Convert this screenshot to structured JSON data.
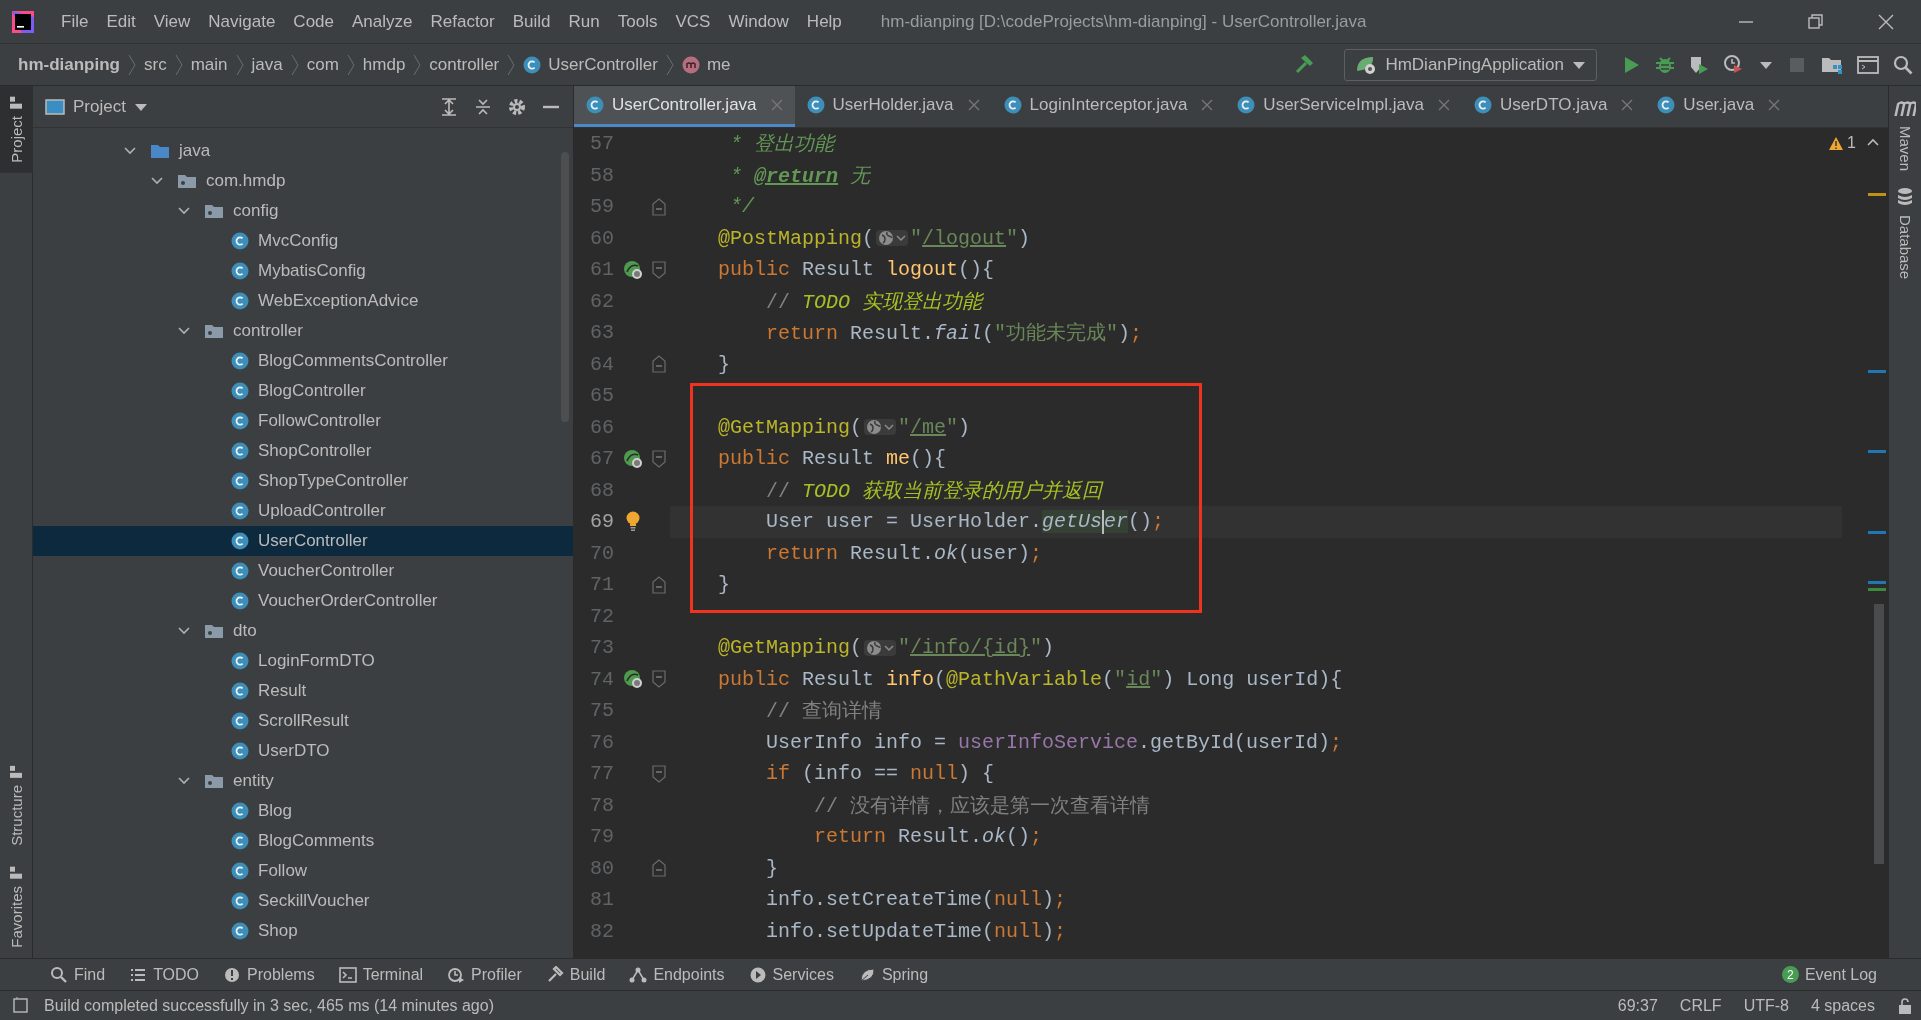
{
  "window": {
    "title": "hm-dianping [D:\\codeProjects\\hm-dianping] - UserController.java"
  },
  "menu": [
    "File",
    "Edit",
    "View",
    "Navigate",
    "Code",
    "Analyze",
    "Refactor",
    "Build",
    "Run",
    "Tools",
    "VCS",
    "Window",
    "Help"
  ],
  "breadcrumbs": [
    {
      "label": "hm-dianping",
      "kind": "project"
    },
    {
      "label": "src",
      "kind": "folder"
    },
    {
      "label": "main",
      "kind": "folder"
    },
    {
      "label": "java",
      "kind": "folder"
    },
    {
      "label": "com",
      "kind": "folder"
    },
    {
      "label": "hmdp",
      "kind": "folder"
    },
    {
      "label": "controller",
      "kind": "folder"
    },
    {
      "label": "UserController",
      "kind": "class"
    },
    {
      "label": "me",
      "kind": "method"
    }
  ],
  "run_config": {
    "label": "HmDianPingApplication"
  },
  "left_tools": [
    {
      "label": "Project",
      "selected": true,
      "kind": "top"
    },
    {
      "label": "Structure",
      "selected": false,
      "kind": "bottom"
    },
    {
      "label": "Favorites",
      "selected": false,
      "kind": "bottom"
    }
  ],
  "right_tools": [
    {
      "label": "Maven",
      "kind": "maven"
    },
    {
      "label": "Database",
      "kind": "database"
    }
  ],
  "project_panel": {
    "title": "Project",
    "tree": [
      {
        "label": "java",
        "kind": "source",
        "expanded": true,
        "selected": false,
        "children": [
          {
            "label": "com.hmdp",
            "kind": "package",
            "expanded": true,
            "selected": false,
            "children": [
              {
                "label": "config",
                "kind": "package",
                "expanded": true,
                "selected": false,
                "children": [
                  {
                    "label": "MvcConfig",
                    "kind": "class",
                    "selected": false
                  },
                  {
                    "label": "MybatisConfig",
                    "kind": "class",
                    "selected": false
                  },
                  {
                    "label": "WebExceptionAdvice",
                    "kind": "class",
                    "selected": false
                  }
                ]
              },
              {
                "label": "controller",
                "kind": "package",
                "expanded": true,
                "selected": false,
                "children": [
                  {
                    "label": "BlogCommentsController",
                    "kind": "class",
                    "selected": false
                  },
                  {
                    "label": "BlogController",
                    "kind": "class",
                    "selected": false
                  },
                  {
                    "label": "FollowController",
                    "kind": "class",
                    "selected": false
                  },
                  {
                    "label": "ShopController",
                    "kind": "class",
                    "selected": false
                  },
                  {
                    "label": "ShopTypeController",
                    "kind": "class",
                    "selected": false
                  },
                  {
                    "label": "UploadController",
                    "kind": "class",
                    "selected": false
                  },
                  {
                    "label": "UserController",
                    "kind": "class",
                    "selected": true
                  },
                  {
                    "label": "VoucherController",
                    "kind": "class",
                    "selected": false
                  },
                  {
                    "label": "VoucherOrderController",
                    "kind": "class",
                    "selected": false
                  }
                ]
              },
              {
                "label": "dto",
                "kind": "package",
                "expanded": true,
                "selected": false,
                "children": [
                  {
                    "label": "LoginFormDTO",
                    "kind": "class",
                    "selected": false
                  },
                  {
                    "label": "Result",
                    "kind": "class",
                    "selected": false
                  },
                  {
                    "label": "ScrollResult",
                    "kind": "class",
                    "selected": false
                  },
                  {
                    "label": "UserDTO",
                    "kind": "class",
                    "selected": false
                  }
                ]
              },
              {
                "label": "entity",
                "kind": "package",
                "expanded": true,
                "selected": false,
                "children": [
                  {
                    "label": "Blog",
                    "kind": "class",
                    "selected": false
                  },
                  {
                    "label": "BlogComments",
                    "kind": "class",
                    "selected": false
                  },
                  {
                    "label": "Follow",
                    "kind": "class",
                    "selected": false
                  },
                  {
                    "label": "SeckillVoucher",
                    "kind": "class",
                    "selected": false
                  },
                  {
                    "label": "Shop",
                    "kind": "class",
                    "selected": false
                  }
                ]
              }
            ]
          }
        ]
      }
    ]
  },
  "tabs": [
    {
      "label": "UserController.java",
      "selected": true
    },
    {
      "label": "UserHolder.java",
      "selected": false
    },
    {
      "label": "LoginInterceptor.java",
      "selected": false
    },
    {
      "label": "UserServiceImpl.java",
      "selected": false
    },
    {
      "label": "UserDTO.java",
      "selected": false
    },
    {
      "label": "User.java",
      "selected": false
    }
  ],
  "inspections": {
    "warnings": "1"
  },
  "code": [
    {
      "boxed": false,
      "lines": [
        {
          "number": "57",
          "current": false,
          "kind": "doc",
          "tokens": [
            {
              "kind": "doc",
              "text": "* 登出功能"
            }
          ]
        },
        {
          "number": "58",
          "current": false,
          "kind": "doc",
          "tokens": [
            {
              "kind": "doc",
              "text": "* "
            },
            {
              "kind": "doctag",
              "text": "@return"
            },
            {
              "kind": "doc",
              "text": " 无"
            }
          ]
        },
        {
          "number": "59",
          "current": false,
          "kind": "doc",
          "fold": {
            "kind": "end"
          },
          "tokens": [
            {
              "kind": "doc",
              "text": "*/"
            }
          ]
        },
        {
          "number": "60",
          "current": false,
          "kind": "member",
          "tokens": [
            {
              "kind": "ann",
              "text": "@PostMapping"
            },
            {
              "kind": "plain",
              "text": "("
            },
            {
              "kind": "inlay"
            },
            {
              "kind": "str",
              "text": "\""
            },
            {
              "kind": "url",
              "text": "/logout"
            },
            {
              "kind": "str",
              "text": "\""
            },
            {
              "kind": "plain",
              "text": ")"
            }
          ]
        },
        {
          "number": "61",
          "current": false,
          "kind": "member",
          "gutter": {
            "kind": "endpoint"
          },
          "fold": {
            "kind": "start"
          },
          "tokens": [
            {
              "kind": "kw",
              "text": "public"
            },
            {
              "kind": "plain",
              "text": " Result "
            },
            {
              "kind": "decl",
              "text": "logout"
            },
            {
              "kind": "plain",
              "text": "(){"
            }
          ]
        },
        {
          "number": "62",
          "current": false,
          "kind": "body",
          "tokens": [
            {
              "kind": "comment",
              "text": "// "
            },
            {
              "kind": "todo",
              "text": "TODO 实现登出功能"
            }
          ]
        },
        {
          "number": "63",
          "current": false,
          "kind": "body",
          "tokens": [
            {
              "kind": "kw",
              "text": "return"
            },
            {
              "kind": "plain",
              "text": " Result."
            },
            {
              "kind": "static",
              "text": "fail"
            },
            {
              "kind": "plain",
              "text": "("
            },
            {
              "kind": "str",
              "text": "\"功能未完成\""
            },
            {
              "kind": "plain",
              "text": ")"
            },
            {
              "kind": "kw",
              "text": ";"
            }
          ]
        },
        {
          "number": "64",
          "current": false,
          "kind": "member",
          "fold": {
            "kind": "end"
          },
          "tokens": [
            {
              "kind": "plain",
              "text": "}"
            }
          ]
        }
      ]
    },
    {
      "boxed": true,
      "lines": [
        {
          "number": "65",
          "current": false,
          "kind": "blank"
        },
        {
          "number": "66",
          "current": false,
          "kind": "member",
          "tokens": [
            {
              "kind": "ann",
              "text": "@GetMapping"
            },
            {
              "kind": "plain",
              "text": "("
            },
            {
              "kind": "inlay"
            },
            {
              "kind": "str",
              "text": "\""
            },
            {
              "kind": "url",
              "text": "/me"
            },
            {
              "kind": "str",
              "text": "\""
            },
            {
              "kind": "plain",
              "text": ")"
            }
          ]
        },
        {
          "number": "67",
          "current": false,
          "kind": "member",
          "gutter": {
            "kind": "endpoint"
          },
          "fold": {
            "kind": "start"
          },
          "tokens": [
            {
              "kind": "kw",
              "text": "public"
            },
            {
              "kind": "plain",
              "text": " Result "
            },
            {
              "kind": "decl",
              "text": "me"
            },
            {
              "kind": "plain",
              "text": "(){"
            }
          ]
        },
        {
          "number": "68",
          "current": false,
          "kind": "body",
          "tokens": [
            {
              "kind": "comment",
              "text": "// "
            },
            {
              "kind": "todo",
              "text": "TODO 获取当前登录的用户并返回"
            }
          ]
        },
        {
          "number": "69",
          "current": true,
          "kind": "body",
          "gutter": {
            "kind": "bulb"
          },
          "tokens": [
            {
              "kind": "plain",
              "text": "User user = UserHolder."
            },
            {
              "kind": "usage",
              "text": "getUs"
            },
            {
              "kind": "caret"
            },
            {
              "kind": "usage",
              "text": "er"
            },
            {
              "kind": "plain",
              "text": "()"
            },
            {
              "kind": "kw",
              "text": ";"
            }
          ]
        },
        {
          "number": "70",
          "current": false,
          "kind": "body",
          "tokens": [
            {
              "kind": "kw",
              "text": "return"
            },
            {
              "kind": "plain",
              "text": " Result."
            },
            {
              "kind": "static",
              "text": "ok"
            },
            {
              "kind": "plain",
              "text": "(user)"
            },
            {
              "kind": "kw",
              "text": ";"
            }
          ]
        },
        {
          "number": "71",
          "current": false,
          "kind": "member",
          "fold": {
            "kind": "end"
          },
          "tokens": [
            {
              "kind": "plain",
              "text": "}"
            }
          ]
        }
      ]
    },
    {
      "boxed": false,
      "lines": [
        {
          "number": "72",
          "current": false,
          "kind": "blank"
        },
        {
          "number": "73",
          "current": false,
          "kind": "member",
          "tokens": [
            {
              "kind": "ann",
              "text": "@GetMapping"
            },
            {
              "kind": "plain",
              "text": "("
            },
            {
              "kind": "inlay"
            },
            {
              "kind": "str",
              "text": "\""
            },
            {
              "kind": "url",
              "text": "/info/{id}"
            },
            {
              "kind": "str",
              "text": "\""
            },
            {
              "kind": "plain",
              "text": ")"
            }
          ]
        },
        {
          "number": "74",
          "current": false,
          "kind": "member",
          "gutter": {
            "kind": "endpoint"
          },
          "fold": {
            "kind": "start"
          },
          "tokens": [
            {
              "kind": "kw",
              "text": "public"
            },
            {
              "kind": "plain",
              "text": " Result "
            },
            {
              "kind": "decl",
              "text": "info"
            },
            {
              "kind": "plain",
              "text": "("
            },
            {
              "kind": "ann",
              "text": "@PathVariable"
            },
            {
              "kind": "plain",
              "text": "("
            },
            {
              "kind": "str",
              "text": "\""
            },
            {
              "kind": "url",
              "text": "id"
            },
            {
              "kind": "str",
              "text": "\""
            },
            {
              "kind": "plain",
              "text": ") Long userId){"
            }
          ]
        },
        {
          "number": "75",
          "current": false,
          "kind": "body",
          "tokens": [
            {
              "kind": "comment",
              "text": "// 查询详情"
            }
          ]
        },
        {
          "number": "76",
          "current": false,
          "kind": "body",
          "tokens": [
            {
              "kind": "plain",
              "text": "UserInfo info = "
            },
            {
              "kind": "field",
              "text": "userInfoService"
            },
            {
              "kind": "plain",
              "text": ".getById(userId)"
            },
            {
              "kind": "kw",
              "text": ";"
            }
          ]
        },
        {
          "number": "77",
          "current": false,
          "kind": "body",
          "fold": {
            "kind": "start"
          },
          "tokens": [
            {
              "kind": "kw",
              "text": "if"
            },
            {
              "kind": "plain",
              "text": " (info == "
            },
            {
              "kind": "kw",
              "text": "null"
            },
            {
              "kind": "plain",
              "text": ") {"
            }
          ]
        },
        {
          "number": "78",
          "current": false,
          "kind": "nested",
          "tokens": [
            {
              "kind": "comment",
              "text": "// 没有详情，应该是第一次查看详情"
            }
          ]
        },
        {
          "number": "79",
          "current": false,
          "kind": "nested",
          "tokens": [
            {
              "kind": "kw",
              "text": "return"
            },
            {
              "kind": "plain",
              "text": " Result."
            },
            {
              "kind": "static",
              "text": "ok"
            },
            {
              "kind": "plain",
              "text": "()"
            },
            {
              "kind": "kw",
              "text": ";"
            }
          ]
        },
        {
          "number": "80",
          "current": false,
          "kind": "body",
          "fold": {
            "kind": "end"
          },
          "tokens": [
            {
              "kind": "plain",
              "text": "}"
            }
          ]
        },
        {
          "number": "81",
          "current": false,
          "kind": "body",
          "tokens": [
            {
              "kind": "plain",
              "text": "info.setCreateTime("
            },
            {
              "kind": "kw",
              "text": "null"
            },
            {
              "kind": "plain",
              "text": ")"
            },
            {
              "kind": "kw",
              "text": ";"
            }
          ]
        },
        {
          "number": "82",
          "current": false,
          "kind": "body",
          "tokens": [
            {
              "kind": "plain",
              "text": "info.setUpdateTime("
            },
            {
              "kind": "kw",
              "text": "null"
            },
            {
              "kind": "plain",
              "text": ")"
            },
            {
              "kind": "kw",
              "text": ";"
            }
          ]
        }
      ]
    }
  ],
  "bottom_tools": [
    {
      "label": "Find",
      "kind": "find"
    },
    {
      "label": "TODO",
      "kind": "todo"
    },
    {
      "label": "Problems",
      "kind": "problems"
    },
    {
      "label": "Terminal",
      "kind": "terminal"
    },
    {
      "label": "Profiler",
      "kind": "profiler"
    },
    {
      "label": "Build",
      "kind": "build"
    },
    {
      "label": "Endpoints",
      "kind": "endpoints"
    },
    {
      "label": "Services",
      "kind": "services"
    },
    {
      "label": "Spring",
      "kind": "spring"
    }
  ],
  "event_log": {
    "label": "Event Log",
    "count": "2"
  },
  "status_bar": {
    "message": "Build completed successfully in 3 sec, 465 ms (14 minutes ago)",
    "items": [
      "69:37",
      "CRLF",
      "UTF-8",
      "4 spaces"
    ]
  }
}
